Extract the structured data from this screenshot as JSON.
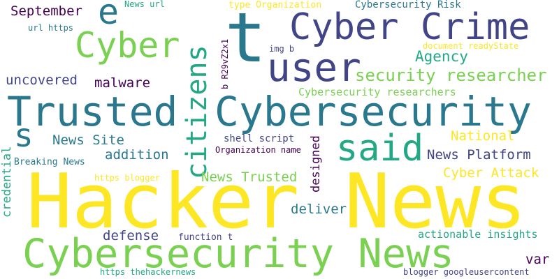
{
  "palette": {
    "yellow": "#fde725",
    "lime": "#7ad151",
    "green": "#22a884",
    "teal": "#2a788e",
    "blue": "#414487",
    "purple": "#440154"
  },
  "words": [
    {
      "text": "Hacker News",
      "color": "#fde725",
      "weight": 1.0
    },
    {
      "text": "Cybersecurity News",
      "color": "#7ad151",
      "weight": 0.82
    },
    {
      "text": "Trusted",
      "color": "#2a788e",
      "weight": 0.78
    },
    {
      "text": "Cybersecurity",
      "color": "#2a788e",
      "weight": 0.76
    },
    {
      "text": "t",
      "color": "#2a788e",
      "weight": 0.75
    },
    {
      "text": "user",
      "color": "#414487",
      "weight": 0.6
    },
    {
      "text": "Cyber Crime",
      "color": "#414487",
      "weight": 0.58
    },
    {
      "text": "said",
      "color": "#22a884",
      "weight": 0.55
    },
    {
      "text": "citizens",
      "color": "#22a884",
      "weight": 0.52
    },
    {
      "text": "Cyber",
      "color": "#7ad151",
      "weight": 0.5
    },
    {
      "text": "e",
      "color": "#2a788e",
      "weight": 0.5
    },
    {
      "text": "s",
      "color": "#2a788e",
      "weight": 0.45
    },
    {
      "text": "security researcher",
      "color": "#7ad151",
      "weight": 0.3
    },
    {
      "text": "Agency",
      "color": "#22a884",
      "weight": 0.28
    },
    {
      "text": "September",
      "color": "#440154",
      "weight": 0.27
    },
    {
      "text": "uncovered",
      "color": "#414487",
      "weight": 0.27
    },
    {
      "text": "malware",
      "color": "#440154",
      "weight": 0.27
    },
    {
      "text": "News Site",
      "color": "#2a788e",
      "weight": 0.27
    },
    {
      "text": "addition",
      "color": "#2a788e",
      "weight": 0.27
    },
    {
      "text": "News Platform",
      "color": "#414487",
      "weight": 0.27
    },
    {
      "text": "News Trusted",
      "color": "#7ad151",
      "weight": 0.26
    },
    {
      "text": "deliver",
      "color": "#2a788e",
      "weight": 0.26
    },
    {
      "text": "defense",
      "color": "#414487",
      "weight": 0.26
    },
    {
      "text": "Cyber Attack",
      "color": "#fde725",
      "weight": 0.25
    },
    {
      "text": "National",
      "color": "#fde725",
      "weight": 0.25
    },
    {
      "text": "designed",
      "color": "#440154",
      "weight": 0.25
    },
    {
      "text": "credential",
      "color": "#22a884",
      "weight": 0.25
    },
    {
      "text": "var",
      "color": "#440154",
      "weight": 0.24
    },
    {
      "text": "Cybersecurity researchers",
      "color": "#7ad151",
      "weight": 0.2
    },
    {
      "text": "actionable insights",
      "color": "#22a884",
      "weight": 0.2
    },
    {
      "text": "Cybersecurity Risk",
      "color": "#2a788e",
      "weight": 0.18
    },
    {
      "text": "shell script",
      "color": "#414487",
      "weight": 0.18
    },
    {
      "text": "Breaking News",
      "color": "#2a788e",
      "weight": 0.17
    },
    {
      "text": "function t",
      "color": "#414487",
      "weight": 0.17
    },
    {
      "text": "type Organization",
      "color": "#fde725",
      "weight": 0.16
    },
    {
      "text": "document readyState",
      "color": "#fde725",
      "weight": 0.16
    },
    {
      "text": "News url",
      "color": "#22a884",
      "weight": 0.15
    },
    {
      "text": "url https",
      "color": "#2a788e",
      "weight": 0.15
    },
    {
      "text": "img b",
      "color": "#414487",
      "weight": 0.15
    },
    {
      "text": "b R29vZ2x1",
      "color": "#440154",
      "weight": 0.15
    },
    {
      "text": "Organization name",
      "color": "#440154",
      "weight": 0.15
    },
    {
      "text": "https blogger",
      "color": "#fde725",
      "weight": 0.15
    },
    {
      "text": "https thehackernews",
      "color": "#22a884",
      "weight": 0.15
    },
    {
      "text": "blogger googleusercontent",
      "color": "#414487",
      "weight": 0.15
    }
  ]
}
